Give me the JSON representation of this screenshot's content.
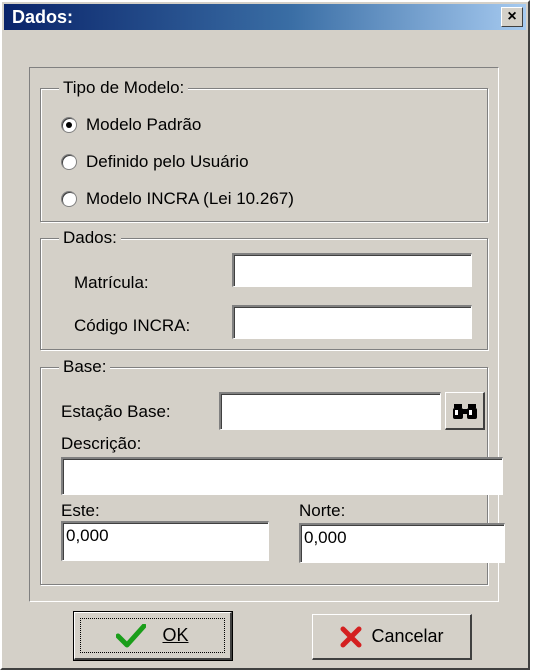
{
  "window": {
    "title": "Dados:",
    "close_glyph": "×"
  },
  "tipo_modelo": {
    "legend": "Tipo de Modelo:",
    "options": [
      {
        "label": "Modelo Padrão",
        "selected": true
      },
      {
        "label": "Definido pelo Usuário",
        "selected": false
      },
      {
        "label": "Modelo INCRA (Lei 10.267)",
        "selected": false
      }
    ]
  },
  "dados": {
    "legend": "Dados:",
    "matricula_label": "Matrícula:",
    "matricula_value": "",
    "codigo_label": "Código INCRA:",
    "codigo_value": ""
  },
  "base": {
    "legend": "Base:",
    "estacao_label": "Estação Base:",
    "estacao_value": "",
    "search_icon": "binoculars-icon",
    "descricao_label": "Descrição:",
    "descricao_value": "",
    "este_label": "Este:",
    "este_value": "0,000",
    "norte_label": "Norte:",
    "norte_value": "0,000"
  },
  "buttons": {
    "ok_label": "OK",
    "ok_icon": "checkmark-icon",
    "cancel_label": "Cancelar",
    "cancel_icon": "x-mark-icon"
  },
  "colors": {
    "ok_check": "#1a9e1a",
    "cancel_x": "#d42020",
    "titlebar": "#0a246a"
  }
}
